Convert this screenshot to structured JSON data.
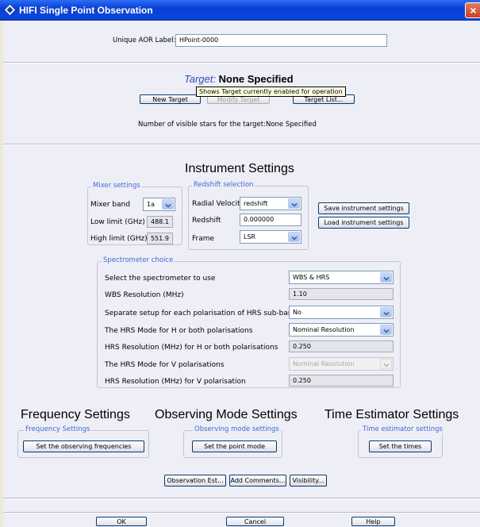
{
  "window": {
    "title": "HIFI Single Point Observation",
    "close_glyph": "×"
  },
  "aor": {
    "label": "Unique AOR Label:",
    "value": "HPoint-0000"
  },
  "target": {
    "prefix": "Target:",
    "value": "None Specified",
    "tooltip": "Shows Target currently enabled for operation",
    "new_label": "New Target",
    "modify_label": "Modify Target",
    "list_label": "Target List...",
    "visible_stars": "Number of visible stars for the target:None Specified"
  },
  "instrument": {
    "heading": "Instrument Settings",
    "mixer": {
      "legend": "Mixer settings",
      "band_label": "Mixer band",
      "band_value": "1a",
      "low_label": "Low limit (GHz)",
      "low_value": "488.1",
      "high_label": "High limit (GHz)",
      "high_value": "551.9"
    },
    "redshift": {
      "legend": "Redshift selection",
      "rv_label": "Radial Velocity",
      "rv_value": "redshift",
      "z_label": "Redshift",
      "z_value": "0.000000",
      "frame_label": "Frame",
      "frame_value": "LSR"
    },
    "save_label": "Save instrument settings",
    "load_label": "Load instrument settings"
  },
  "spectrometer": {
    "legend": "Spectrometer choice",
    "rows": [
      {
        "label": "Select the spectrometer to use",
        "value": "WBS & HRS"
      },
      {
        "label": "WBS Resolution (MHz)",
        "value": "1.10"
      },
      {
        "label": "Separate setup for each polarisation of HRS sub-bands?",
        "value": "No"
      },
      {
        "label": "The HRS Mode for H or both polarisations",
        "value": "Nominal Resolution"
      },
      {
        "label": "HRS Resolution (MHz) for H or both polarisations",
        "value": "0.250"
      },
      {
        "label": "The HRS Mode for V polarisations",
        "value": "Nominal Resolution"
      },
      {
        "label": "HRS Resolution (MHz) for V polarisation",
        "value": "0.250"
      }
    ]
  },
  "sections": {
    "freq_heading": "Frequency Settings",
    "freq_legend": "Frequency Settings",
    "freq_button": "Set the observing frequencies",
    "obs_heading": "Observing Mode Settings",
    "obs_legend": "Observing mode settings",
    "obs_button": "Set the point mode",
    "time_heading": "Time Estimator Settings",
    "time_legend": "Time estimator settings",
    "time_button": "Set the times"
  },
  "tools": {
    "obs_est": "Observation Est...",
    "comments": "Add Comments...",
    "visibility": "Visibility..."
  },
  "footer": {
    "ok": "OK",
    "cancel": "Cancel",
    "help": "Help"
  },
  "colors": {
    "title_bar": "#0a46d9",
    "legend_text": "#3d6ad8",
    "target_prefix": "#2a4fb8",
    "panel_bg": "#eeeef6"
  }
}
